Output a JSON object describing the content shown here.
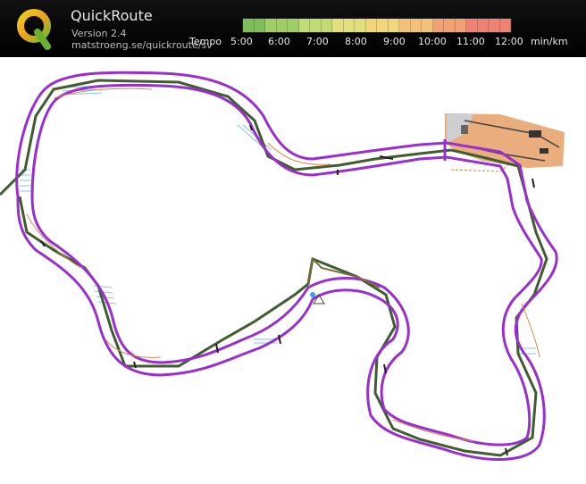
{
  "header": {
    "app_name": "QuickRoute",
    "version": "Version 2.4",
    "url": "matstroeng.se/quickroute/sv"
  },
  "legend": {
    "title": "Tempo",
    "unit": "min/km",
    "ticks": [
      "5:00",
      "6:00",
      "7:00",
      "8:00",
      "9:00",
      "10:00",
      "11:00",
      "12:00"
    ],
    "colors": [
      "#7fbf59",
      "#a0ce66",
      "#c2dc73",
      "#e2e07c",
      "#f2d77a",
      "#f4c178",
      "#f2a173",
      "#ef8373"
    ]
  },
  "colors": {
    "route": "#9a2fd0",
    "track": "#3f5d2e",
    "map_background": "#ffffff"
  }
}
